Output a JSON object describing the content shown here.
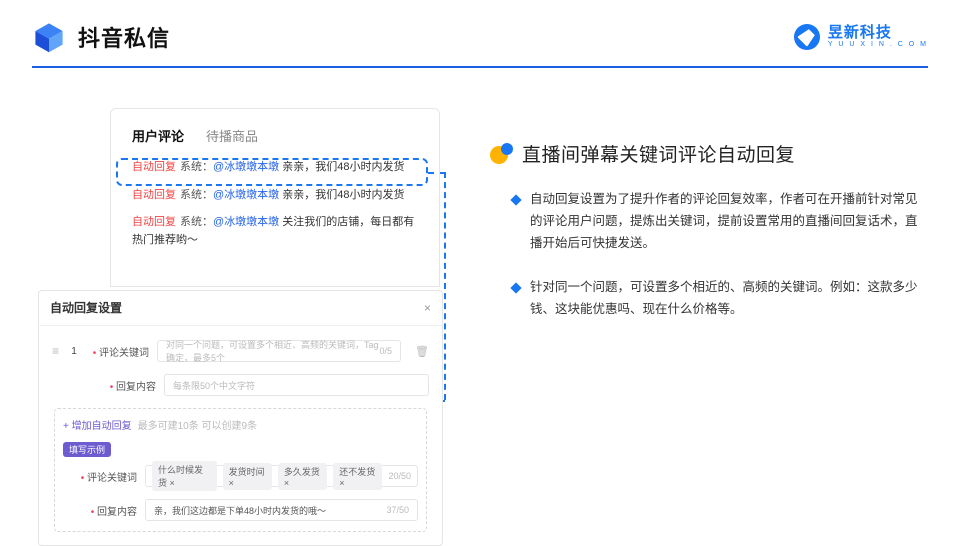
{
  "header": {
    "title": "抖音私信",
    "brand_cn": "昱新科技",
    "brand_en": "Y U U X I N . C O M"
  },
  "comment_card": {
    "tab_active": "用户评论",
    "tab_inactive": "待播商品",
    "rows": [
      {
        "label": "自动回复",
        "sys": "系统：",
        "link": "@冰墩墩本墩",
        "text": " 亲亲，我们48小时内发货"
      },
      {
        "label": "自动回复",
        "sys": "系统：",
        "link": "@冰墩墩本墩",
        "text": " 亲亲，我们48小时内发货"
      },
      {
        "label": "自动回复",
        "sys": "系统：",
        "link": "@冰墩墩本墩",
        "text": " 关注我们的店铺，每日都有热门推荐哟～"
      }
    ]
  },
  "settings": {
    "title": "自动回复设置",
    "row1_index": "1",
    "row1_label": "评论关键词",
    "row1_placeholder": "对同一个问题，可设置多个相近、高频的关键词，Tag确定，最多5个",
    "row1_counter": "0/5",
    "row2_label": "回复内容",
    "row2_text": "每条限50个中文字符",
    "add_label": "+ 增加自动回复",
    "add_hint": "最多可建10条 可以创建9条",
    "badge": "填写示例",
    "ex_row1_label": "评论关键词",
    "ex_chips": [
      "什么时候发货 ×",
      "发货时间 ×",
      "多久发货 ×",
      "还不发货 ×"
    ],
    "ex_row1_counter": "20/50",
    "ex_row2_label": "回复内容",
    "ex_row2_text": "亲，我们这边都是下单48小时内发货的哦～",
    "ex_row2_counter": "37/50"
  },
  "right": {
    "title": "直播间弹幕关键词评论自动回复",
    "bullets": [
      "自动回复设置为了提升作者的评论回复效率，作者可在开播前针对常见的评论用户问题，提炼出关键词，提前设置常用的直播间回复话术，直播开始后可快捷发送。",
      "针对同一个问题，可设置多个相近的、高频的关键词。例如：这款多少钱、这块能优惠吗、现在什么价格等。"
    ]
  }
}
